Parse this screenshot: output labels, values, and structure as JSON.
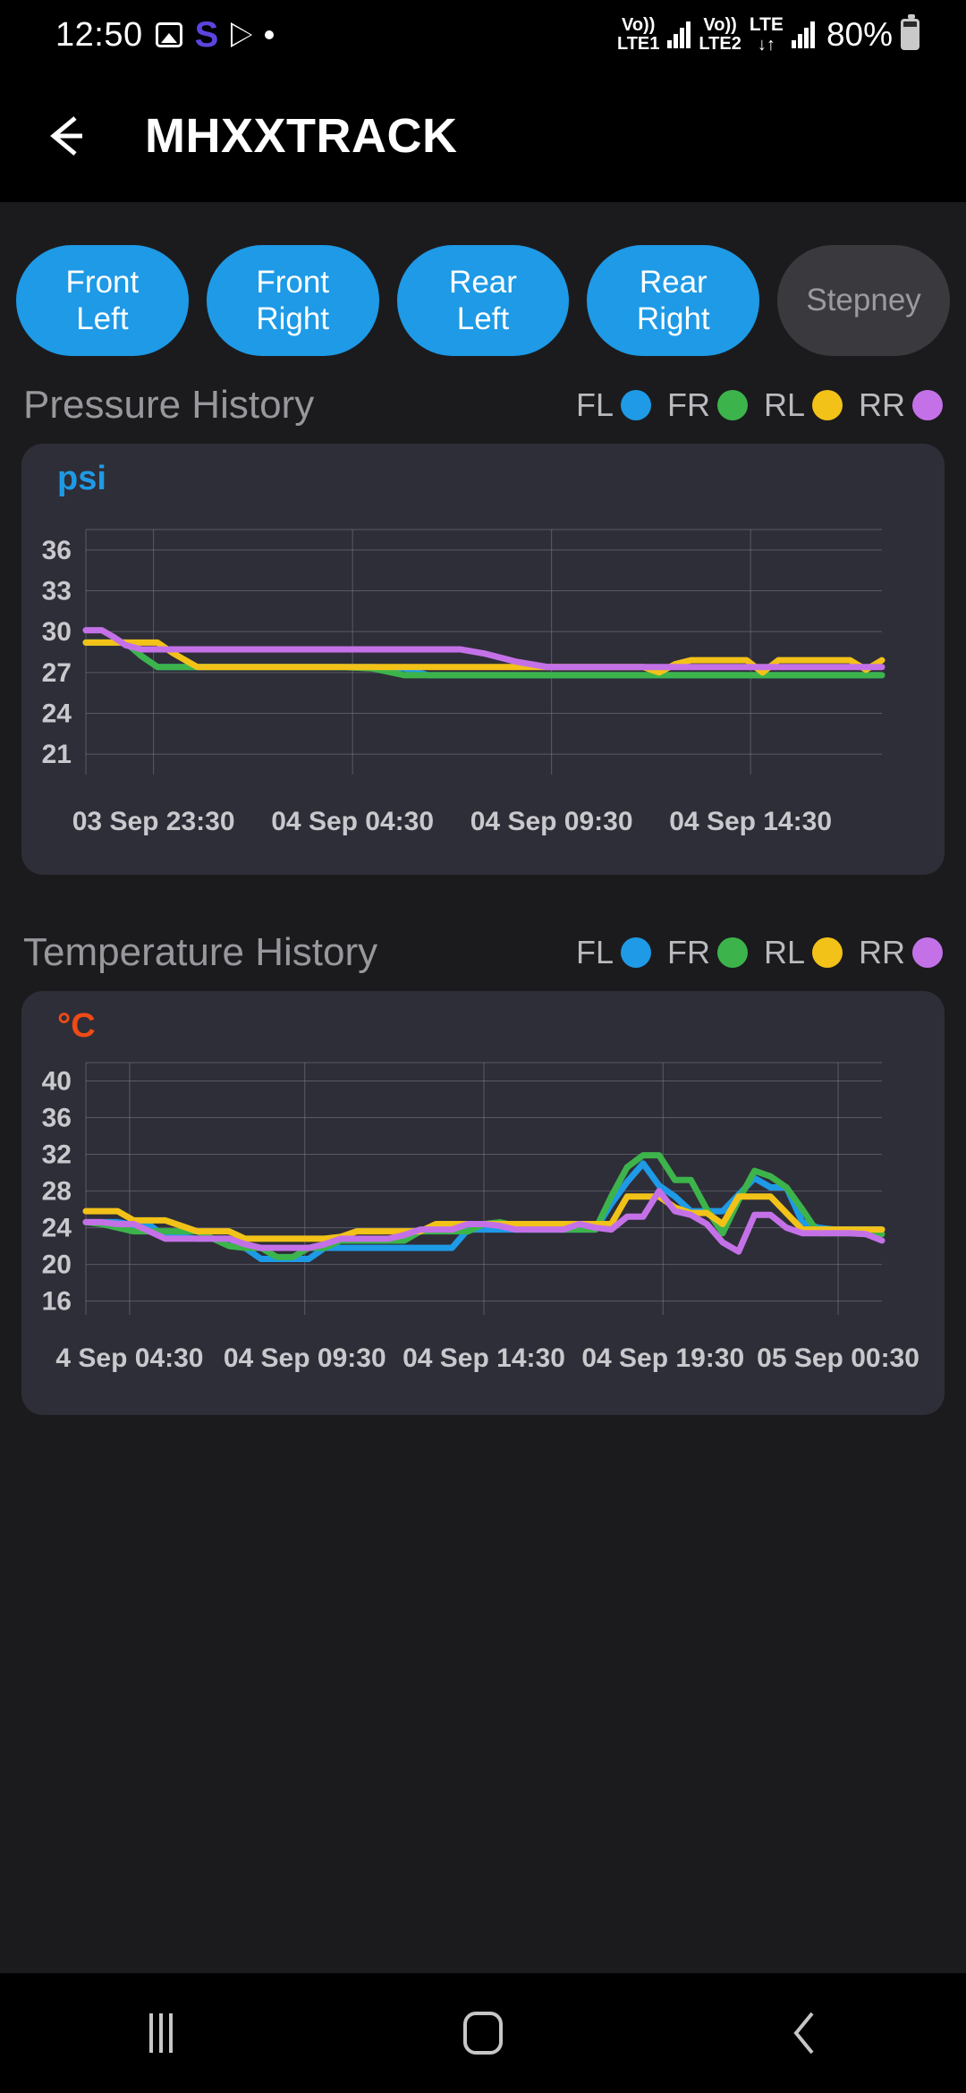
{
  "status_bar": {
    "time": "12:50",
    "icons": [
      "photo-icon",
      "samsung-internet-icon",
      "play-store-icon",
      "dot-icon"
    ],
    "samsung_glyph": "S",
    "sim1": {
      "volte": "Vo))",
      "label": "LTE1"
    },
    "sim2": {
      "volte": "Vo))",
      "label": "LTE2",
      "network": "LTE",
      "arrows": "↓↑"
    },
    "battery_percent": "80%"
  },
  "app_bar": {
    "back_icon": "arrow-left-icon",
    "title": "MHXXTRACK"
  },
  "tire_chips": [
    {
      "label_line1": "Front",
      "label_line2": "Left",
      "state": "active"
    },
    {
      "label_line1": "Front",
      "label_line2": "Right",
      "state": "active"
    },
    {
      "label_line1": "Rear",
      "label_line2": "Left",
      "state": "active"
    },
    {
      "label_line1": "Rear",
      "label_line2": "Right",
      "state": "active"
    },
    {
      "label_line1": "Stepney",
      "label_line2": "",
      "state": "inactive"
    }
  ],
  "colors": {
    "FL": "#1e9ae6",
    "FR": "#3cb44b",
    "RL": "#f2c218",
    "RR": "#c471e8",
    "psi_unit": "#1e9ae6",
    "celsius_unit": "#f04a16",
    "grid": "#7e7e8c",
    "card_bg": "#2e2e38",
    "page_bg": "#1b1b1e",
    "chip_active": "#1e9ae6",
    "chip_inactive": "#3a3a3e"
  },
  "legend": [
    {
      "label": "FL",
      "color": "#1e9ae6"
    },
    {
      "label": "FR",
      "color": "#3cb44b"
    },
    {
      "label": "RL",
      "color": "#f2c218"
    },
    {
      "label": "RR",
      "color": "#c471e8"
    }
  ],
  "pressure_section": {
    "title": "Pressure History"
  },
  "temperature_section": {
    "title": "Temperature History"
  },
  "nav_bar": {
    "recents_icon": "recents-icon",
    "home_icon": "home-icon",
    "back_icon": "back-chevron-icon"
  },
  "chart_data": [
    {
      "type": "line",
      "id": "pressure-history",
      "title": "Pressure History",
      "ylabel": "psi",
      "xlabel": "",
      "ylim": [
        19.5,
        37.5
      ],
      "yticks": [
        36,
        33,
        30,
        27,
        24,
        21
      ],
      "grid": true,
      "legend_position": "top-right",
      "xtick_labels": [
        "03 Sep 23:30",
        "04 Sep 04:30",
        "04 Sep 09:30",
        "04 Sep 14:30"
      ],
      "xtick_positions": [
        0.085,
        0.335,
        0.585,
        0.835
      ],
      "x": [
        0.0,
        0.02,
        0.035,
        0.05,
        0.07,
        0.09,
        0.11,
        0.14,
        0.17,
        0.2,
        0.24,
        0.28,
        0.32,
        0.36,
        0.4,
        0.43,
        0.45,
        0.47,
        0.5,
        0.54,
        0.58,
        0.62,
        0.66,
        0.7,
        0.72,
        0.74,
        0.76,
        0.79,
        0.81,
        0.83,
        0.85,
        0.87,
        0.89,
        0.905,
        0.92,
        0.94,
        0.96,
        0.98,
        1.0
      ],
      "series": [
        {
          "name": "FL",
          "color": "#1e9ae6",
          "values": [
            29.2,
            29.2,
            29.2,
            29.2,
            28.2,
            27.4,
            27.4,
            27.4,
            27.4,
            27.4,
            27.4,
            27.4,
            27.4,
            27.4,
            27.3,
            26.8,
            26.8,
            26.8,
            26.8,
            26.8,
            26.8,
            26.8,
            26.8,
            26.8,
            26.8,
            26.8,
            26.8,
            26.8,
            26.8,
            26.8,
            26.8,
            26.8,
            26.8,
            26.8,
            26.8,
            26.8,
            26.8,
            26.8,
            26.8
          ]
        },
        {
          "name": "FR",
          "color": "#3cb44b",
          "values": [
            29.2,
            29.2,
            29.2,
            29.2,
            28.2,
            27.4,
            27.4,
            27.4,
            27.4,
            27.4,
            27.4,
            27.4,
            27.4,
            27.3,
            26.8,
            26.8,
            26.8,
            26.8,
            26.8,
            26.8,
            26.8,
            26.8,
            26.8,
            26.8,
            26.8,
            26.8,
            26.8,
            26.8,
            26.8,
            26.8,
            26.8,
            26.8,
            26.8,
            26.8,
            26.8,
            26.8,
            26.8,
            26.8,
            26.8
          ]
        },
        {
          "name": "RL",
          "color": "#f2c218",
          "values": [
            29.2,
            29.2,
            29.2,
            29.2,
            29.2,
            29.2,
            28.4,
            27.4,
            27.4,
            27.4,
            27.4,
            27.4,
            27.4,
            27.4,
            27.4,
            27.4,
            27.4,
            27.4,
            27.4,
            27.4,
            27.4,
            27.4,
            27.4,
            27.4,
            27.0,
            27.6,
            27.9,
            27.9,
            27.9,
            27.9,
            27.0,
            27.9,
            27.9,
            27.9,
            27.9,
            27.9,
            27.9,
            27.2,
            27.9
          ]
        },
        {
          "name": "RR",
          "color": "#c471e8",
          "values": [
            30.1,
            30.1,
            29.6,
            29.0,
            28.7,
            28.7,
            28.7,
            28.7,
            28.7,
            28.7,
            28.7,
            28.7,
            28.7,
            28.7,
            28.7,
            28.7,
            28.7,
            28.7,
            28.4,
            27.8,
            27.4,
            27.4,
            27.4,
            27.4,
            27.4,
            27.4,
            27.4,
            27.4,
            27.4,
            27.4,
            27.4,
            27.4,
            27.4,
            27.4,
            27.4,
            27.4,
            27.4,
            27.4,
            27.4
          ]
        }
      ]
    },
    {
      "type": "line",
      "id": "temperature-history",
      "title": "Temperature History",
      "ylabel": "°C",
      "xlabel": "",
      "ylim": [
        14.5,
        42.0
      ],
      "yticks": [
        40,
        36,
        32,
        28,
        24,
        20,
        16
      ],
      "grid": true,
      "legend_position": "top-right",
      "xtick_labels": [
        "4 Sep 04:30",
        "04 Sep 09:30",
        "04 Sep 14:30",
        "04 Sep 19:30",
        "05 Sep 00:30"
      ],
      "xtick_positions": [
        0.055,
        0.275,
        0.5,
        0.725,
        0.945
      ],
      "x": [
        0.0,
        0.02,
        0.04,
        0.06,
        0.08,
        0.1,
        0.12,
        0.14,
        0.16,
        0.18,
        0.2,
        0.22,
        0.24,
        0.26,
        0.28,
        0.3,
        0.32,
        0.34,
        0.36,
        0.38,
        0.4,
        0.42,
        0.44,
        0.46,
        0.48,
        0.5,
        0.52,
        0.54,
        0.56,
        0.58,
        0.6,
        0.62,
        0.64,
        0.66,
        0.68,
        0.7,
        0.72,
        0.74,
        0.76,
        0.78,
        0.8,
        0.82,
        0.84,
        0.86,
        0.88,
        0.9,
        0.92,
        0.94,
        0.96,
        0.98,
        1.0
      ],
      "series": [
        {
          "name": "FL",
          "color": "#1e9ae6",
          "values": [
            24.6,
            24.6,
            24.6,
            24.3,
            24.3,
            23.0,
            23.0,
            22.8,
            22.8,
            22.8,
            21.8,
            20.6,
            20.6,
            20.6,
            20.6,
            21.8,
            21.8,
            21.8,
            21.8,
            21.8,
            21.8,
            21.8,
            21.8,
            21.8,
            23.8,
            23.8,
            23.8,
            23.8,
            23.8,
            23.8,
            23.8,
            23.8,
            23.8,
            26.6,
            29.0,
            31.0,
            28.6,
            27.4,
            25.8,
            25.8,
            25.8,
            27.6,
            29.4,
            28.4,
            28.4,
            24.6,
            24.0,
            23.8,
            23.8,
            23.8,
            23.8
          ]
        },
        {
          "name": "FR",
          "color": "#3cb44b",
          "values": [
            24.6,
            24.4,
            24.0,
            23.6,
            23.6,
            23.6,
            23.6,
            23.6,
            22.8,
            22.0,
            21.8,
            21.8,
            20.8,
            20.8,
            21.8,
            21.8,
            22.6,
            22.6,
            22.6,
            22.6,
            22.6,
            23.6,
            23.6,
            23.6,
            23.6,
            24.4,
            24.6,
            24.2,
            23.8,
            23.8,
            23.8,
            23.8,
            23.8,
            27.4,
            30.6,
            31.9,
            31.9,
            29.2,
            29.2,
            26.0,
            23.4,
            27.0,
            30.2,
            29.6,
            28.4,
            26.0,
            23.4,
            23.4,
            23.4,
            23.3,
            23.3
          ]
        },
        {
          "name": "RL",
          "color": "#f2c218",
          "values": [
            25.8,
            25.8,
            25.8,
            24.8,
            24.8,
            24.8,
            24.2,
            23.6,
            23.6,
            23.6,
            22.8,
            22.8,
            22.8,
            22.8,
            22.8,
            22.8,
            23.0,
            23.6,
            23.6,
            23.6,
            23.6,
            23.6,
            24.4,
            24.4,
            24.4,
            24.4,
            24.4,
            24.4,
            24.4,
            24.4,
            24.4,
            24.4,
            24.4,
            24.4,
            27.4,
            27.4,
            27.4,
            26.2,
            25.6,
            25.6,
            24.4,
            27.4,
            27.4,
            27.4,
            25.6,
            23.8,
            23.8,
            23.8,
            23.8,
            23.8,
            23.8
          ]
        },
        {
          "name": "RR",
          "color": "#c471e8",
          "values": [
            24.6,
            24.6,
            24.4,
            24.4,
            23.6,
            22.8,
            22.8,
            22.8,
            22.8,
            22.8,
            22.2,
            21.8,
            21.8,
            21.8,
            21.8,
            22.2,
            22.8,
            22.8,
            22.8,
            22.8,
            23.2,
            23.8,
            23.8,
            23.8,
            24.4,
            24.4,
            24.2,
            23.8,
            23.8,
            23.8,
            23.8,
            24.4,
            24.0,
            23.8,
            25.2,
            25.2,
            28.0,
            25.8,
            25.4,
            24.4,
            22.4,
            21.4,
            25.4,
            25.4,
            24.0,
            23.4,
            23.4,
            23.4,
            23.4,
            23.3,
            22.6
          ]
        }
      ]
    }
  ]
}
